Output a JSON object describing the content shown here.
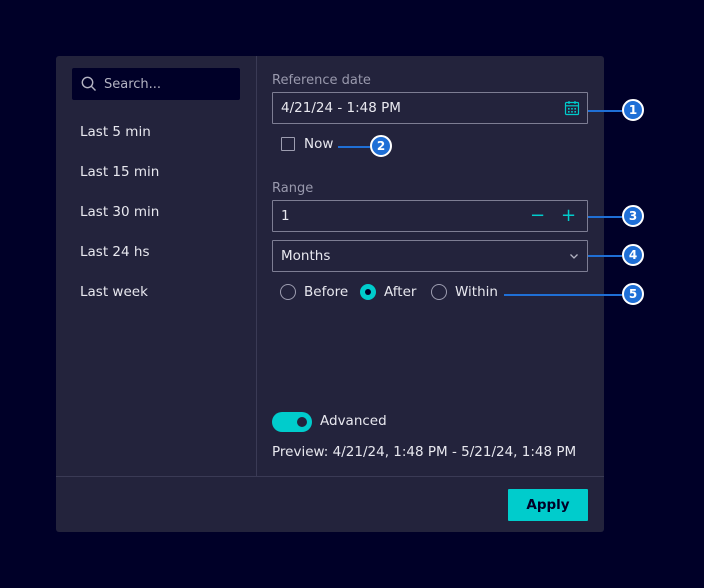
{
  "search": {
    "placeholder": "Search..."
  },
  "presets": [
    "Last 5 min",
    "Last 15 min",
    "Last 30 min",
    "Last 24 hs",
    "Last week"
  ],
  "reference": {
    "label": "Reference date",
    "value": "4/21/24 - 1:48 PM",
    "now_label": "Now",
    "now_checked": false
  },
  "range": {
    "label": "Range",
    "value": "1",
    "decrement": "−",
    "increment": "+",
    "unit": "Months",
    "options": [
      "Before",
      "After",
      "Within"
    ],
    "selected": "After"
  },
  "advanced": {
    "label": "Advanced",
    "enabled": true
  },
  "preview": "Preview: 4/21/24, 1:48 PM - 5/21/24, 1:48 PM",
  "apply_label": "Apply",
  "callouts": [
    "1",
    "2",
    "3",
    "4",
    "5"
  ],
  "colors": {
    "accent": "#00cccc",
    "background": "#000028",
    "panel": "#23233c",
    "callout": "#1f6fd6"
  }
}
